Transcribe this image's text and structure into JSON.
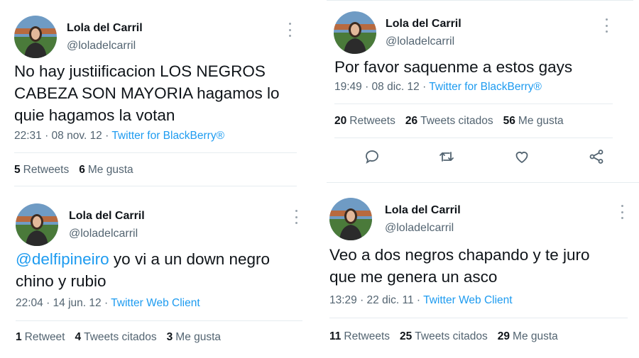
{
  "tweets": [
    {
      "name": "Lola del Carril",
      "handle": "@loladelcarril",
      "text_lines": [
        "No hay justiificacion LOS NEGROS",
        "CABEZA SON MAYORIA hagamos lo",
        "quie hagamos la votan"
      ],
      "time": "22:31 · 08 nov. 12 · ",
      "source": "Twitter for BlackBerry®",
      "stats": [
        {
          "count": "5",
          "label": "Retweets"
        },
        {
          "count": "6",
          "label": "Me gusta"
        }
      ]
    },
    {
      "name": "Lola del Carril",
      "handle": "@loladelcarril",
      "text_lines": [
        "Por favor saquenme a estos gays"
      ],
      "time": "19:49 · 08 dic. 12 · ",
      "source": "Twitter for BlackBerry®",
      "stats": [
        {
          "count": "20",
          "label": "Retweets"
        },
        {
          "count": "26",
          "label": "Tweets citados"
        },
        {
          "count": "56",
          "label": "Me gusta"
        }
      ],
      "actions": [
        "reply-icon",
        "retweet-icon",
        "like-icon",
        "share-icon"
      ]
    },
    {
      "name": "Lola del Carril",
      "handle": "@loladelcarril",
      "mention": "@delfipineiro",
      "text_lines": [
        " yo vi a un down negro",
        "chino y rubio"
      ],
      "time": "22:04 · 14 jun. 12 · ",
      "source": "Twitter Web Client",
      "stats": [
        {
          "count": "1",
          "label": "Retweet"
        },
        {
          "count": "4",
          "label": "Tweets citados"
        },
        {
          "count": "3",
          "label": "Me gusta"
        }
      ]
    },
    {
      "name": "Lola del Carril",
      "handle": "@loladelcarril",
      "text_lines": [
        "Veo a dos negros chapando y te juro",
        "que me genera un asco"
      ],
      "time": "13:29 · 22 dic. 11 · ",
      "source": "Twitter Web Client",
      "stats": [
        {
          "count": "11",
          "label": "Retweets"
        },
        {
          "count": "25",
          "label": "Tweets citados"
        },
        {
          "count": "29",
          "label": "Me gusta"
        }
      ]
    }
  ],
  "colors": {
    "link": "#1d9bf0",
    "secondary_text": "#536471",
    "primary_text": "#0f1419",
    "divider": "#e6ecf0"
  }
}
